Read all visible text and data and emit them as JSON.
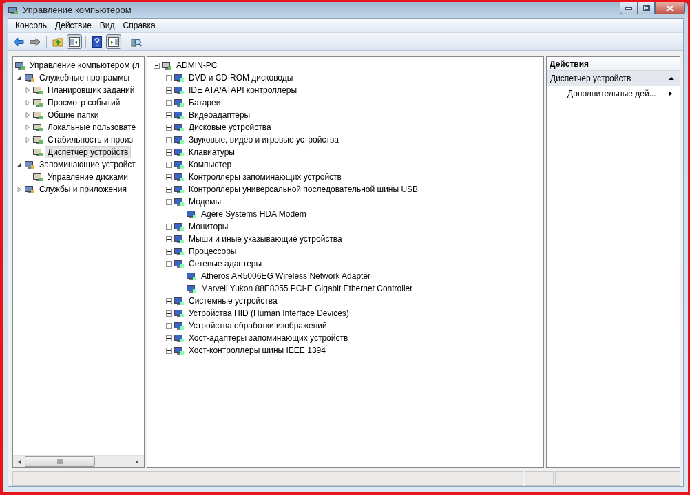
{
  "window": {
    "title": "Управление компьютером"
  },
  "menu": [
    {
      "label": "Консоль"
    },
    {
      "label": "Действие"
    },
    {
      "label": "Вид"
    },
    {
      "label": "Справка"
    }
  ],
  "toolbar": [
    {
      "kind": "back",
      "pressed": false
    },
    {
      "kind": "forward",
      "pressed": false
    },
    {
      "kind": "sep"
    },
    {
      "kind": "up",
      "pressed": false
    },
    {
      "kind": "tree",
      "pressed": true
    },
    {
      "kind": "sep"
    },
    {
      "kind": "help",
      "pressed": false
    },
    {
      "kind": "actions",
      "pressed": true
    },
    {
      "kind": "sep"
    },
    {
      "kind": "scan",
      "pressed": false
    }
  ],
  "console_tree": [
    {
      "label": "Управление компьютером (л",
      "selected": false,
      "children": [
        {
          "label": "Служебные программы",
          "selected": false,
          "expanded": true,
          "children": [
            {
              "label": "Планировщик заданий",
              "selected": false,
              "expanded": false
            },
            {
              "label": "Просмотр событий",
              "selected": false,
              "expanded": false
            },
            {
              "label": "Общие папки",
              "selected": false,
              "expanded": false
            },
            {
              "label": "Локальные пользовате",
              "selected": false,
              "expanded": false
            },
            {
              "label": "Стабильность и произ",
              "selected": false,
              "expanded": false
            },
            {
              "label": "Диспетчер устройств",
              "selected": true
            }
          ]
        },
        {
          "label": "Запоминающие устройст",
          "selected": false,
          "expanded": true,
          "children": [
            {
              "label": "Управление дисками",
              "selected": false
            }
          ]
        },
        {
          "label": "Службы и приложения",
          "selected": false,
          "expanded": false
        }
      ]
    }
  ],
  "devices": [
    {
      "label": "ADMIN-PC",
      "expanded": true,
      "children": [
        {
          "label": "DVD и CD-ROM дисководы",
          "expanded": false
        },
        {
          "label": "IDE ATA/ATAPI контроллеры",
          "expanded": false
        },
        {
          "label": "Батареи",
          "expanded": false
        },
        {
          "label": "Видеоадаптеры",
          "expanded": false
        },
        {
          "label": "Дисковые устройства",
          "expanded": false
        },
        {
          "label": "Звуковые, видео и игровые устройства",
          "expanded": false
        },
        {
          "label": "Клавиатуры",
          "expanded": false
        },
        {
          "label": "Компьютер",
          "expanded": false
        },
        {
          "label": "Контроллеры запоминающих устройств",
          "expanded": false
        },
        {
          "label": "Контроллеры универсальной последовательной шины USB",
          "expanded": false
        },
        {
          "label": "Модемы",
          "expanded": true,
          "children": [
            {
              "label": "Agere Systems HDA Modem"
            }
          ]
        },
        {
          "label": "Мониторы",
          "expanded": false
        },
        {
          "label": "Мыши и иные указывающие устройства",
          "expanded": false
        },
        {
          "label": "Процессоры",
          "expanded": false
        },
        {
          "label": "Сетевые адаптеры",
          "expanded": true,
          "children": [
            {
              "label": "Atheros AR5006EG Wireless Network Adapter"
            },
            {
              "label": "Marvell Yukon 88E8055 PCI-E Gigabit Ethernet Controller"
            }
          ]
        },
        {
          "label": "Системные устройства",
          "expanded": false
        },
        {
          "label": "Устройства HID (Human Interface Devices)",
          "expanded": false
        },
        {
          "label": "Устройства обработки изображений",
          "expanded": false
        },
        {
          "label": "Хост-адаптеры запоминающих устройств",
          "expanded": false
        },
        {
          "label": "Хост-контроллеры шины IEEE 1394",
          "expanded": false
        }
      ]
    }
  ],
  "actions": {
    "title": "Действия",
    "sections": [
      {
        "label": "Диспетчер устройств",
        "expanded": true,
        "items": [
          {
            "label": "Дополнительные дей..."
          }
        ]
      }
    ]
  }
}
